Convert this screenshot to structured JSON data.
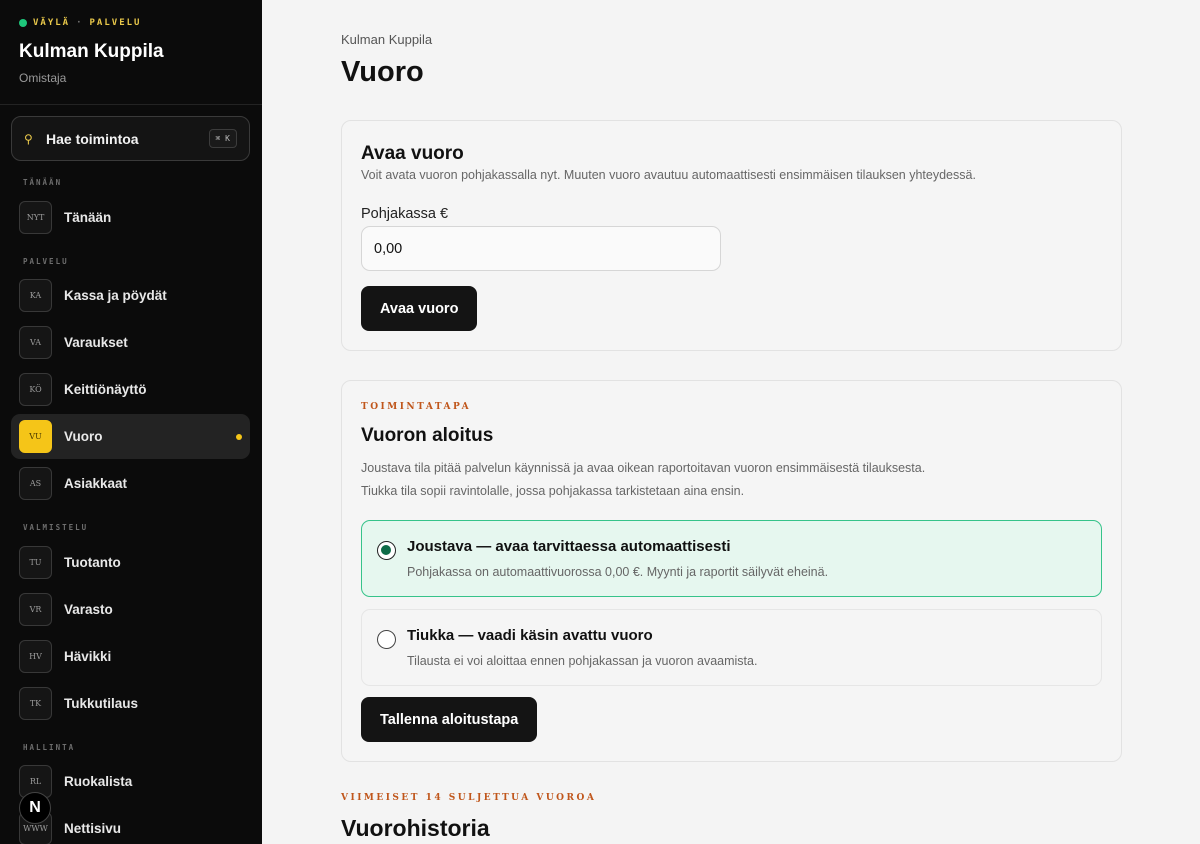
{
  "brand": {
    "tag_left": "VÄYLÄ",
    "tag_sep": "·",
    "tag_right": "PALVELU",
    "title": "Kulman Kuppila",
    "role": "Omistaja",
    "status_color": "#1ec77b"
  },
  "search": {
    "label": "Hae toimintoa",
    "shortcut": "⌘ K",
    "icon": "search-icon"
  },
  "nav": {
    "sections": {
      "today": "TÄNÄÄN",
      "service": "PALVELU",
      "prep": "VALMISTELU",
      "admin": "HALLINTA"
    },
    "items": [
      {
        "code": "NYT",
        "label": "Tänään"
      },
      {
        "code": "KA",
        "label": "Kassa ja pöydät"
      },
      {
        "code": "VA",
        "label": "Varaukset"
      },
      {
        "code": "KÖ",
        "label": "Keittiönäyttö"
      },
      {
        "code": "VU",
        "label": "Vuoro",
        "active": true
      },
      {
        "code": "AS",
        "label": "Asiakkaat"
      },
      {
        "code": "TU",
        "label": "Tuotanto"
      },
      {
        "code": "VR",
        "label": "Varasto"
      },
      {
        "code": "HV",
        "label": "Hävikki"
      },
      {
        "code": "TK",
        "label": "Tukkutilaus"
      },
      {
        "code": "RL",
        "label": "Ruokalista"
      },
      {
        "code": "WWW",
        "label": "Nettisivu"
      }
    ],
    "accent_color": "#f5c518"
  },
  "floating_badge": "N",
  "page": {
    "breadcrumb": "Kulman Kuppila",
    "title": "Vuoro"
  },
  "open_shift": {
    "title": "Avaa vuoro",
    "description": "Voit avata vuoron pohjakassalla nyt. Muuten vuoro avautuu automaattisesti ensimmäisen tilauksen yhteydessä.",
    "field_label": "Pohjakassa €",
    "field_value": "0,00",
    "button": "Avaa vuoro"
  },
  "start_mode": {
    "eyebrow": "TOIMINTATAPA",
    "title": "Vuoron aloitus",
    "description_line1": "Joustava tila pitää palvelun käynnissä ja avaa oikean raportoitavan vuoron ensimmäisestä tilauksesta.",
    "description_line2": "Tiukka tila sopii ravintolalle, jossa pohjakassa tarkistetaan aina ensin.",
    "options": [
      {
        "title": "Joustava — avaa tarvittaessa automaattisesti",
        "description": "Pohjakassa on automaattivuorossa 0,00 €. Myynti ja raportit säilyvät eheinä.",
        "selected": true
      },
      {
        "title": "Tiukka — vaadi käsin avattu vuoro",
        "description": "Tilausta ei voi aloittaa ennen pohjakassan ja vuoron avaamista.",
        "selected": false
      }
    ],
    "button": "Tallenna aloitustapa",
    "selected_color": "#36c38a"
  },
  "history": {
    "eyebrow": "VIIMEISET 14 SULJETTUA VUOROA",
    "title": "Vuorohistoria"
  }
}
